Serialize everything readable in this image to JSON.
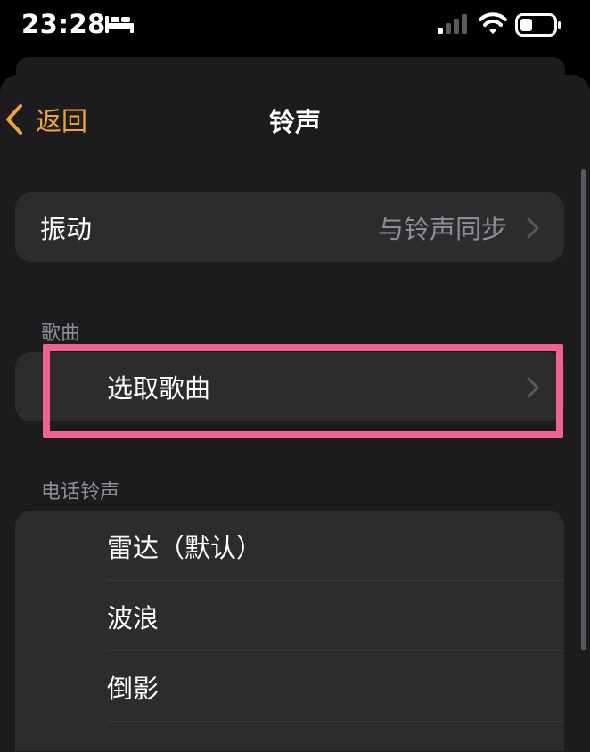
{
  "status_bar": {
    "time": "23:28",
    "icons": [
      "bed-icon",
      "signal-icon",
      "wifi-icon",
      "battery-icon"
    ]
  },
  "nav": {
    "back_label": "返回",
    "title": "铃声"
  },
  "vibration": {
    "label": "振动",
    "value": "与铃声同步"
  },
  "songs_section": {
    "header": "歌曲",
    "pick_song_label": "选取歌曲"
  },
  "ringtones_section": {
    "header": "电话铃声",
    "items": [
      "雷达（默认）",
      "波浪",
      "倒影"
    ]
  },
  "colors": {
    "accent": "#f2a33a",
    "highlight": "#f06292",
    "background": "#1c1c1e",
    "card": "#2c2c2e"
  }
}
